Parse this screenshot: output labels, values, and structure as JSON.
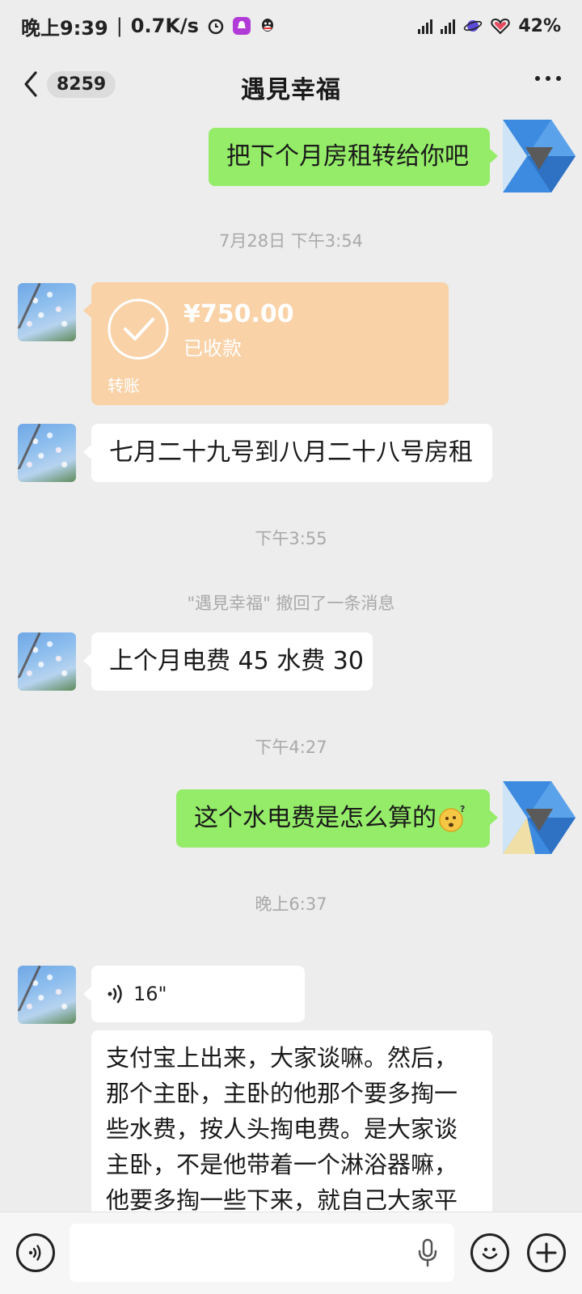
{
  "status_bar": {
    "time": "晚上9:39",
    "separator": "|",
    "net_speed": "0.7K/s",
    "battery": "42%"
  },
  "nav": {
    "unread_count": "8259",
    "title": "遇見幸福"
  },
  "messages": {
    "out1": "把下个月房租转给你吧",
    "ts1": "7月28日 下午3:54",
    "transfer": {
      "amount": "¥750.00",
      "status": "已收款",
      "label": "转账"
    },
    "in1": "七月二十九号到八月二十八号房租",
    "ts2": "下午3:55",
    "recall_notice": "\"遇見幸福\" 撤回了一条消息",
    "in2": "上个月电费 45 水费 30",
    "ts3": "下午4:27",
    "out2": "这个水电费是怎么算的",
    "ts4": "晚上6:37",
    "voice": {
      "duration": "16\""
    },
    "in3": "支付宝上出来，大家谈嘛。然后，那个主卧，主卧的他那个要多掏一些水费，按人头掏电费。是大家谈主卧，不是他带着一个淋浴器嘛，他要多掏一些下来，就自己大家平"
  },
  "colors": {
    "background": "#ededed",
    "outgoing_bubble": "#95ec69",
    "incoming_bubble": "#ffffff",
    "transfer_card": "#f9d2a8",
    "timestamp_text": "#a9a9a9"
  },
  "icons": {
    "back": "chevron-left-icon",
    "more": "more-dots-icon",
    "voice_toggle": "voice-icon",
    "mic": "microphone-icon",
    "emoji": "emoji-icon",
    "plus": "plus-icon"
  }
}
